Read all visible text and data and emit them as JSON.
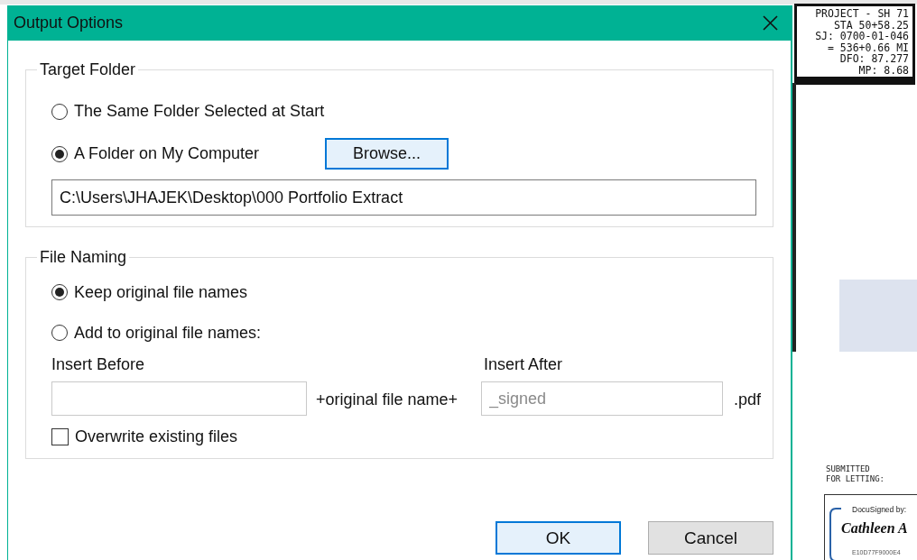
{
  "document": {
    "title_block": [
      "PROJECT - SH 71",
      "STA 50+58.25",
      "SJ: 0700-01-046",
      "= 536+0.66 MI",
      "DFO: 87.277",
      "MP: 8.68"
    ],
    "submitted": [
      "SUBMITTED",
      "FOR LETTING:"
    ],
    "signature": {
      "caption": "DocuSigned by:",
      "name": "Cathleen A",
      "hash": "E10D77F9000E4"
    }
  },
  "dialog": {
    "title": "Output Options",
    "target_folder": {
      "legend": "Target Folder",
      "options": [
        {
          "label": "The Same Folder Selected at Start",
          "selected": false
        },
        {
          "label": "A Folder on My Computer",
          "selected": true
        }
      ],
      "browse_button": "Browse...",
      "path": "C:\\Users\\JHAJEK\\Desktop\\000 Portfolio Extract"
    },
    "file_naming": {
      "legend": "File Naming",
      "options": [
        {
          "label": "Keep original file names",
          "selected": true
        },
        {
          "label": "Add to original file names:",
          "selected": false
        }
      ],
      "insert_before": {
        "label": "Insert Before"
      },
      "joiner": "+original file name+",
      "insert_after": {
        "label": "Insert After",
        "placeholder": "_signed"
      },
      "extension": ".pdf",
      "overwrite": {
        "label": "Overwrite existing files",
        "checked": false
      }
    },
    "buttons": [
      {
        "label": "OK",
        "default": true
      },
      {
        "label": "Cancel",
        "default": false
      }
    ]
  }
}
